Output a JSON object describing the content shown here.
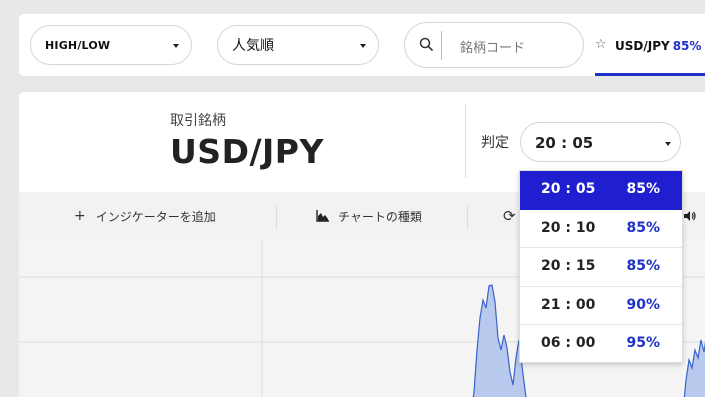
{
  "topbar": {
    "option_type": "HIGH/LOW",
    "sort": "人気順",
    "search_placeholder": "銘柄コード",
    "fav_pair": "USD/JPY",
    "fav_payout": "85%"
  },
  "asset": {
    "label": "取引銘柄",
    "pair": "USD/JPY"
  },
  "expiry": {
    "label": "判定",
    "selected": "20 : 05",
    "options": [
      {
        "time": "20 : 05",
        "payout": "85%"
      },
      {
        "time": "20 : 10",
        "payout": "85%"
      },
      {
        "time": "20 : 15",
        "payout": "85%"
      },
      {
        "time": "21 : 00",
        "payout": "90%"
      },
      {
        "time": "06 : 00",
        "payout": "95%"
      }
    ]
  },
  "toolbar": {
    "add_indicator": "インジケーターを追加",
    "chart_type": "チャートの種類"
  },
  "colors": {
    "accent": "#2032c9",
    "selected_bg": "#1f1fd0",
    "chart_line": "#3a62c9",
    "chart_fill": "#b8c9ee"
  },
  "icons": [
    "search-icon",
    "star-icon",
    "chevron-down-icon",
    "plus-icon",
    "chart-type-icon",
    "refresh-icon",
    "sound-icon"
  ]
}
